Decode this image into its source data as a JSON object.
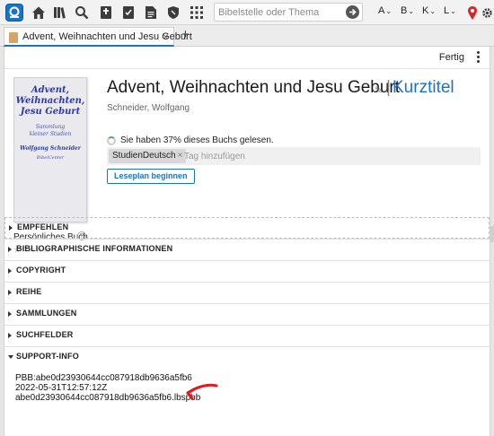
{
  "toolbar": {
    "icons": [
      "app-logo-icon",
      "home-icon",
      "library-icon",
      "search-icon",
      "bible-icon",
      "checklist-icon",
      "notes-icon",
      "shield-icon",
      "grid-icon"
    ],
    "search_placeholder": "Bibelstelle oder Thema",
    "font_buttons": [
      "A",
      "B",
      "K",
      "L"
    ],
    "right_icons": [
      "map-pin-icon",
      "settings-gear-icon"
    ],
    "accent_color": "#1b73c8"
  },
  "tab": {
    "title": "Advent, Weihnachten und Jesu Geburt",
    "close": "×",
    "new_tab": "+"
  },
  "header": {
    "done_label": "Fertig"
  },
  "book": {
    "cover": {
      "title": "Advent,\nWeihnachten,\nJesu Geburt",
      "subtitle": "Sammlung\nkleiner Studien",
      "author": "Wolfgang Schneider",
      "publisher": "BibelCenter"
    },
    "title": "Advent, Weihnachten und Jesu Geburt",
    "separator": "|",
    "short_title_link": "Kurztitel",
    "author": "Schneider, Wolfgang",
    "personal_label": "Persönliches Buch",
    "help": "?",
    "stars": "☆☆☆☆☆",
    "progress_text": "Sie haben 37% dieses Buchs gelesen.",
    "progress_percent": 37,
    "tag_chip": "StudienDeutsch",
    "tag_chip_remove": "×",
    "tag_placeholder": "Tag hinzufügen",
    "reading_plan_button": "Leseplan beginnen"
  },
  "sections": [
    {
      "label": "EMPFEHLEN",
      "expanded": false
    },
    {
      "label": "BIBLIOGRAPHISCHE INFORMATIONEN",
      "expanded": false
    },
    {
      "label": "COPYRIGHT",
      "expanded": false
    },
    {
      "label": "REIHE",
      "expanded": false
    },
    {
      "label": "SAMMLUNGEN",
      "expanded": false
    },
    {
      "label": "SUCHFELDER",
      "expanded": false
    },
    {
      "label": "SUPPORT-INFO",
      "expanded": true
    }
  ],
  "support_info": {
    "line1": "PBB:abe0d23930644cc087918db9636a5fb6",
    "line2": "2022-05-31T12:57:12Z",
    "line3": "abe0d23930644cc087918db9636a5fb6.lbspbb"
  },
  "annotation_color": "#e0191b"
}
